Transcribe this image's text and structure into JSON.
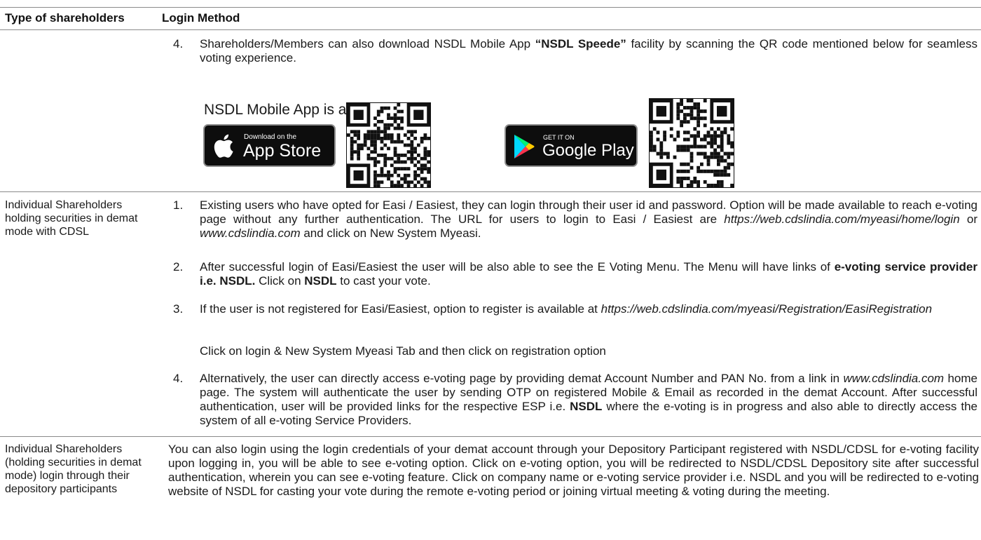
{
  "header": {
    "col1_label": "Type of shareholders",
    "col2_label": "Login Method"
  },
  "section_nsdl_continued": {
    "item4_num": "4.",
    "item4_text_a": "Shareholders/Members can also download NSDL Mobile App ",
    "item4_text_bold": "“NSDL Speede”",
    "item4_text_b": " facility by scanning the QR code mentioned below for seamless voting experience.",
    "available_on": "NSDL Mobile App is available on",
    "app_store": {
      "small": "Download on the",
      "big": "App Store",
      "icon": "apple-icon"
    },
    "google_play": {
      "small": "GET IT ON",
      "big": "Google Play",
      "icon": "play-triangle-icon"
    }
  },
  "section_cdsl": {
    "label": "Individual Shareholders holding securities in demat mode with CDSL",
    "items": [
      {
        "num": "1.",
        "t1": "Existing users who have opted for Easi / Easiest, they can login through their user id and password. Option will be made available to reach e-voting page without any further authentication. The URL for users to login to Easi / Easiest are ",
        "t1_em": "https://web.cdslindia.com/myeasi/home/login",
        "t1_b": " or ",
        "t1_em2": "www.cdslindia.com",
        "t1_c": " and click on New System Myeasi."
      },
      {
        "num": "2.",
        "t1": "After successful login of Easi/Easiest the user will be also able to see the E Voting Menu. The Menu will have links of ",
        "t1_bold": "e-voting service provider i.e. NSDL.",
        "t1_b": " Click on ",
        "t1_bold2": "NSDL",
        "t1_c": " to cast your vote."
      },
      {
        "num": "3.",
        "t1": "If the user is not registered for Easi/Easiest, option to register is available at ",
        "t1_em": "https://web.cdslindia.com/myeasi/Registration/EasiRegistration"
      },
      {
        "plain": "Click on login & New System Myeasi Tab and then click on registration option"
      },
      {
        "num": "4.",
        "t1": "Alternatively, the user can directly access e-voting page by providing demat Account Number and PAN No. from a link in ",
        "t1_em": "www.cdslindia.com",
        "t1_b": " home page. The system will authenticate the user by sending OTP on registered Mobile & Email as recorded in the demat Account. After successful authentication, user will be provided links for the respective ESP i.e. ",
        "t1_bold": "NSDL",
        "t1_c": " where the e-voting is in progress and also able to directly access the system of all e-voting Service Providers."
      }
    ]
  },
  "section_dp": {
    "label": "Individual Shareholders (holding securities in demat mode) login through their depository participants",
    "text": "You can also login using the login credentials of your demat account through your Depository Participant registered with NSDL/CDSL for e-voting facility upon logging in, you will be able to see e-voting option. Click on e-voting option, you will be redirected to NSDL/CDSL Depository site after successful authentication, wherein you can see e-voting feature. Click on company name or e-voting service provider i.e. NSDL and you will be redirected to e-voting website of NSDL for casting your vote during the remote e-voting period or joining virtual meeting & voting during the meeting."
  }
}
